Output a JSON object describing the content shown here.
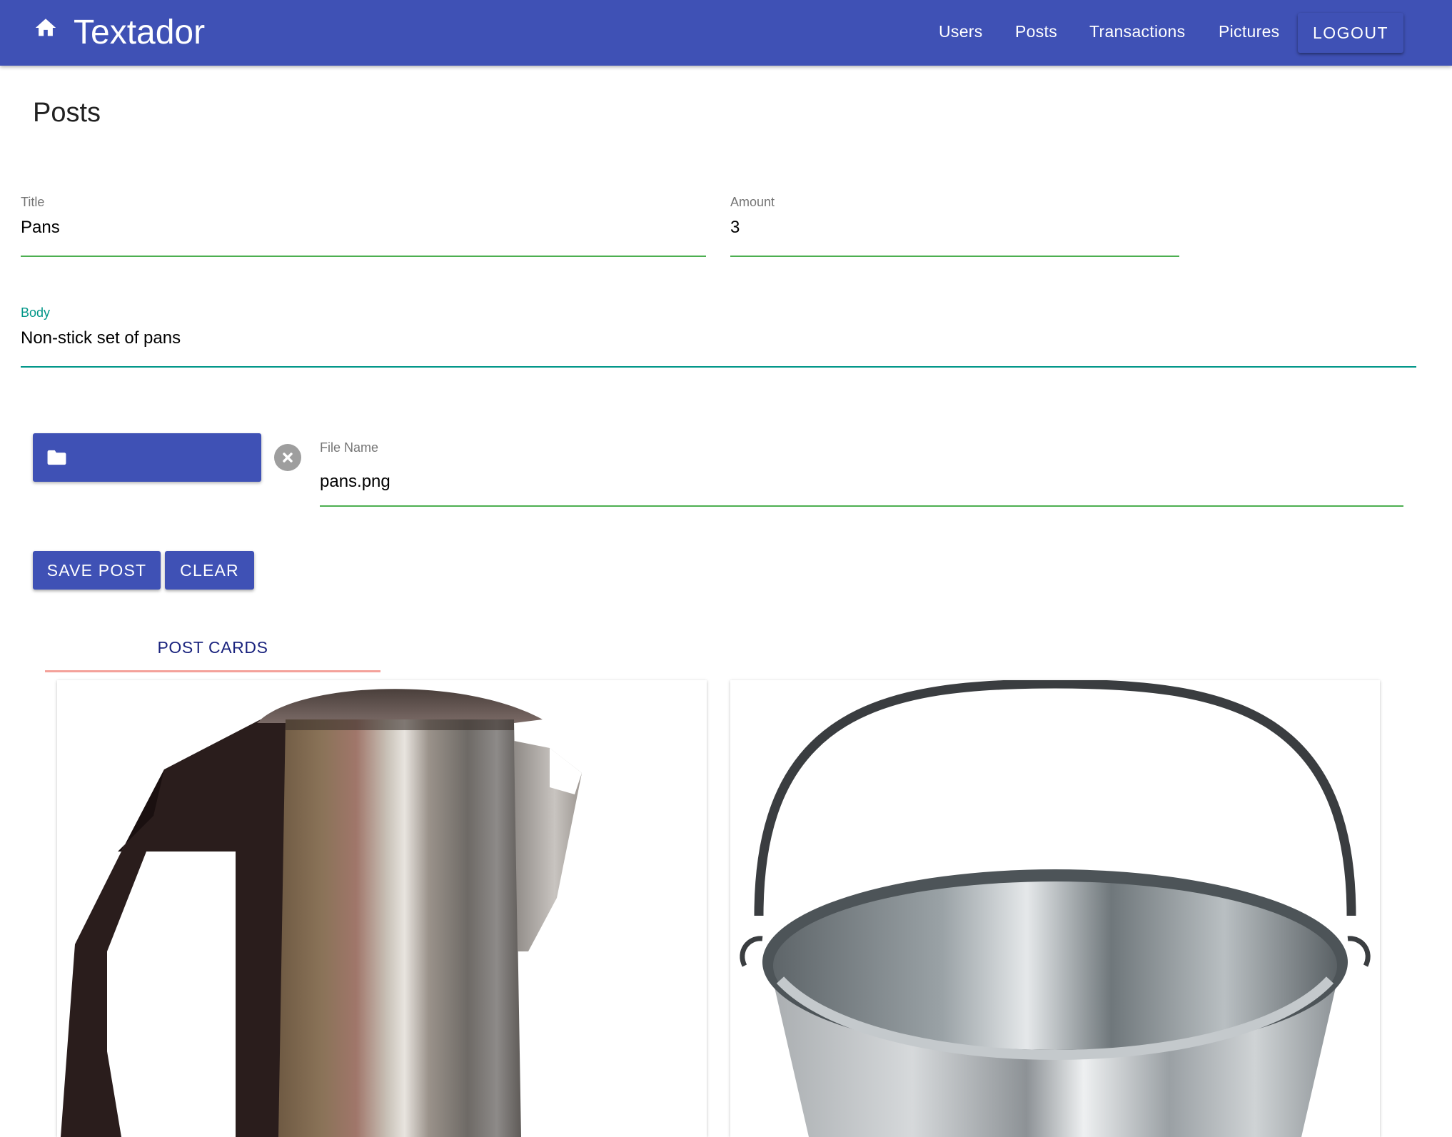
{
  "app": {
    "title": "Textador",
    "home_icon": "home-icon"
  },
  "nav": {
    "links": [
      "Users",
      "Posts",
      "Transactions",
      "Pictures"
    ],
    "logout_label": "LOGOUT"
  },
  "page": {
    "title": "Posts"
  },
  "form": {
    "title": {
      "label": "Title",
      "value": "Pans"
    },
    "amount": {
      "label": "Amount",
      "value": "3"
    },
    "body": {
      "label": "Body",
      "value": "Non-stick set of pans"
    },
    "file": {
      "button_icon": "folder-icon",
      "clear_icon": "close-circle-icon",
      "label": "File Name",
      "value": "pans.png"
    },
    "save_label": "SAVE POST",
    "clear_label": "CLEAR"
  },
  "tabs": [
    {
      "label": "POST CARDS",
      "active": true
    }
  ],
  "cards": [
    {
      "image": "kettle"
    },
    {
      "image": "bucket"
    }
  ],
  "colors": {
    "primary": "#3f51b5",
    "focus": "#009688",
    "underline": "#4caf50",
    "tab_indicator": "#f4a19a",
    "tab_text": "#1a237e"
  }
}
